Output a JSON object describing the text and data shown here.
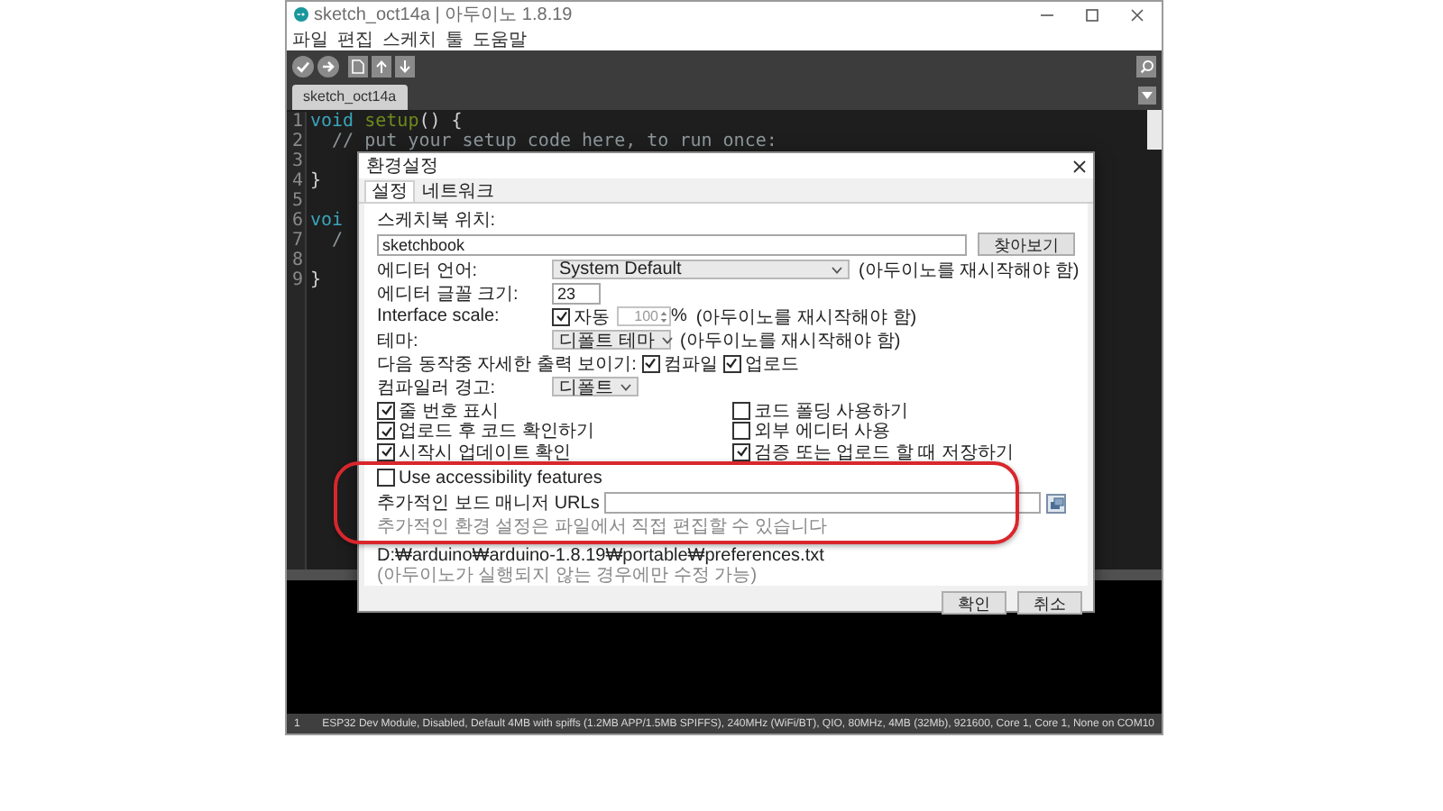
{
  "window": {
    "title": "sketch_oct14a | 아두이노 1.8.19"
  },
  "menu": [
    "파일",
    "편집",
    "스케치",
    "툴",
    "도움말"
  ],
  "sketch_tabs": [
    {
      "label": "sketch_oct14a",
      "selected": true
    }
  ],
  "editor": {
    "lines": [
      {
        "number": "1",
        "tokens": [
          {
            "text": "void",
            "kind": "keyword"
          },
          {
            "text": " setup",
            "kind": "function"
          },
          {
            "text": "() {",
            "kind": "plain"
          }
        ]
      },
      {
        "number": "2",
        "tokens": [
          {
            "text": "  // put your setup code here, to run once:",
            "kind": "comment"
          }
        ]
      },
      {
        "number": "3"
      },
      {
        "number": "4",
        "tokens": [
          {
            "text": "}",
            "kind": "plain"
          }
        ]
      },
      {
        "number": "5"
      },
      {
        "number": "6",
        "tokens": [
          {
            "text": "voi",
            "kind": "keyword"
          }
        ]
      },
      {
        "number": "7",
        "tokens": [
          {
            "text": "  /",
            "kind": "comment"
          }
        ]
      },
      {
        "number": "8"
      },
      {
        "number": "9",
        "tokens": [
          {
            "text": "}",
            "kind": "plain"
          }
        ]
      }
    ]
  },
  "dialog": {
    "title": "환경설정",
    "tabs": [
      {
        "label": "설정",
        "selected": true
      },
      {
        "label": "네트워크",
        "selected": false
      }
    ],
    "sketchbook": {
      "label": "스케치북 위치:",
      "value": "sketchbook",
      "button": "찾아보기"
    },
    "editor_language": {
      "label": "에디터 언어:",
      "value": "System Default",
      "note": "(아두이노를 재시작해야 함)"
    },
    "font_size": {
      "label": "에디터 글꼴 크기:",
      "value": "23"
    },
    "interface_scale": {
      "label": "Interface scale:",
      "auto": {
        "label": "자동",
        "checked": true
      },
      "value": "100",
      "unit": "%",
      "note": "(아두이노를 재시작해야 함)"
    },
    "theme": {
      "label": "테마:",
      "value": "디폴트 테마",
      "note": "(아두이노를 재시작해야 함)"
    },
    "verbose": {
      "label": "다음 동작중 자세한 출력 보이기:",
      "options": [
        {
          "label": "컴파일",
          "checked": true
        },
        {
          "label": "업로드",
          "checked": true
        }
      ]
    },
    "compiler_warnings": {
      "label": "컴파일러 경고:",
      "value": "디폴트"
    },
    "options": [
      {
        "label": "줄 번호 표시",
        "checked": true
      },
      {
        "label": "코드 폴딩 사용하기",
        "checked": false
      },
      {
        "label": "업로드 후 코드 확인하기",
        "checked": true
      },
      {
        "label": "외부 에디터 사용",
        "checked": false
      },
      {
        "label": "시작시 업데이트 확인",
        "checked": true
      },
      {
        "label": "검증 또는 업로드 할 때 저장하기",
        "checked": true
      }
    ],
    "accessibility": {
      "label": "Use accessibility features",
      "checked": false
    },
    "board_urls": {
      "label": "추가적인 보드 매니저 URLs"
    },
    "more_prefs_note": "추가적인 환경 설정은 파일에서 직접 편집할 수 있습니다",
    "prefs_path": "D:₩arduino₩arduino-1.8.19₩portable₩preferences.txt",
    "path_hint": "(아두이노가 실행되지 않는 경우에만 수정 가능)",
    "buttons": [
      "확인",
      "취소"
    ]
  },
  "status_bar": {
    "line": "1",
    "board": "ESP32 Dev Module, Disabled, Default 4MB with spiffs (1.2MB APP/1.5MB SPIFFS), 240MHz (WiFi/BT), QIO, 80MHz, 4MB (32Mb), 921600, Core 1, Core 1, None on COM10"
  }
}
